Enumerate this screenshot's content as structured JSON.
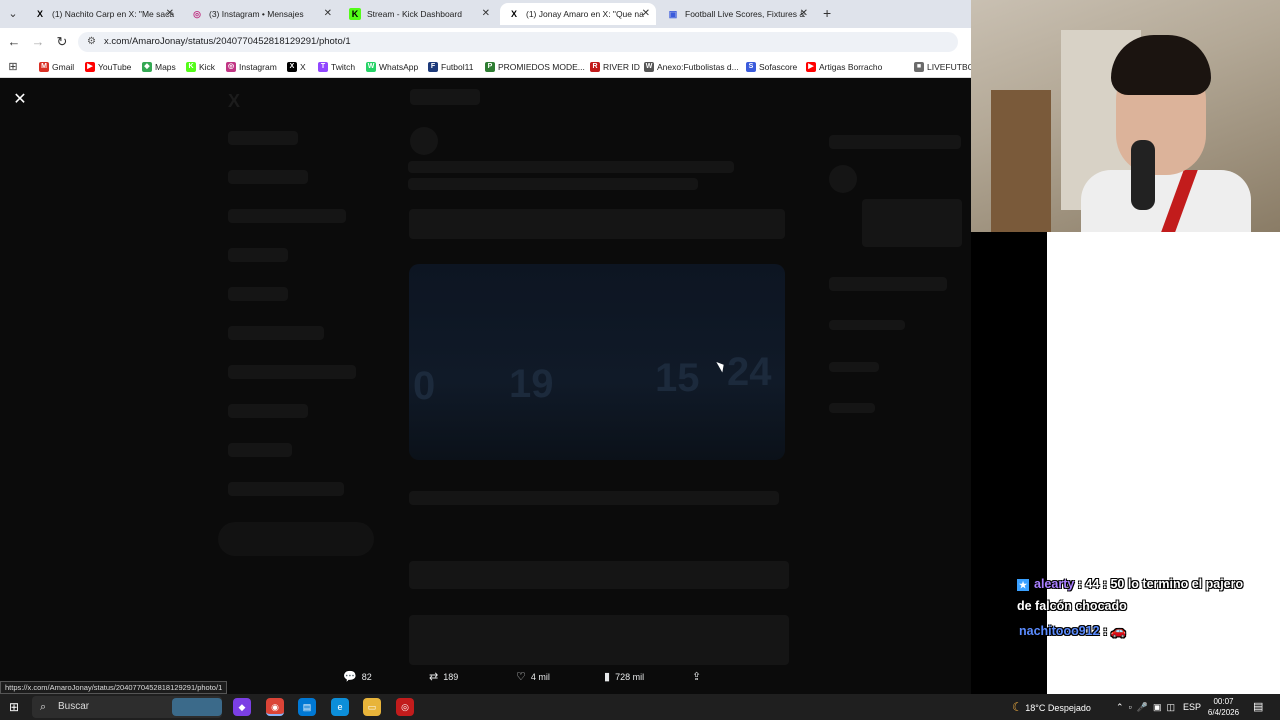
{
  "tabs": [
    {
      "title": "(1) Nachito Carp en X: \"Me saca",
      "icon": "x-logo-icon",
      "fav": "X",
      "active": false
    },
    {
      "title": "(3) Instagram • Mensajes",
      "icon": "instagram-icon",
      "fav": "◎",
      "active": false
    },
    {
      "title": "Stream - Kick Dashboard",
      "icon": "kick-icon",
      "fav": "K",
      "active": false
    },
    {
      "title": "(1) Jonay Amaro en X: \"Que na",
      "icon": "x-logo-icon",
      "fav": "X",
      "active": true
    },
    {
      "title": "Football Live Scores, Fixtures &",
      "icon": "sofascore-icon",
      "fav": "▣",
      "active": false
    }
  ],
  "address": {
    "url": "x.com/AmaroJonay/status/2040770452818129291/photo/1"
  },
  "bookmarks": [
    {
      "label": "Gmail",
      "icon": "gmail-icon",
      "color": "#d93025",
      "glyph": "M"
    },
    {
      "label": "YouTube",
      "icon": "youtube-icon",
      "color": "#ff0000",
      "glyph": "▶"
    },
    {
      "label": "Maps",
      "icon": "maps-icon",
      "color": "#34a853",
      "glyph": "◆"
    },
    {
      "label": "Kick",
      "icon": "kick-icon",
      "color": "#53fc18",
      "glyph": "K"
    },
    {
      "label": "Instagram",
      "icon": "instagram-icon",
      "color": "#c13584",
      "glyph": "◎"
    },
    {
      "label": "X",
      "icon": "x-logo-icon",
      "color": "#000000",
      "glyph": "X"
    },
    {
      "label": "Twitch",
      "icon": "twitch-icon",
      "color": "#9146ff",
      "glyph": "T"
    },
    {
      "label": "WhatsApp",
      "icon": "whatsapp-icon",
      "color": "#25d366",
      "glyph": "W"
    },
    {
      "label": "Futbol11",
      "icon": "futbol11-icon",
      "color": "#1d3a7a",
      "glyph": "F"
    },
    {
      "label": "PROMIEDOS MODE...",
      "icon": "promiedos-icon",
      "color": "#2e7d32",
      "glyph": "P"
    },
    {
      "label": "RIVER ID",
      "icon": "river-icon",
      "color": "#c21c1c",
      "glyph": "R"
    },
    {
      "label": "Anexo:Futbolistas d...",
      "icon": "wikipedia-icon",
      "color": "#555555",
      "glyph": "W"
    },
    {
      "label": "Sofascore",
      "icon": "sofascore-icon",
      "color": "#3b5bdb",
      "glyph": "S"
    },
    {
      "label": "Artigas Borracho",
      "icon": "youtube-icon",
      "color": "#ff0000",
      "glyph": "▶"
    },
    {
      "label": "LIVEFUTBOL",
      "icon": "bookmark-icon",
      "color": "#6b6b6b",
      "glyph": "■"
    }
  ],
  "post_actions": {
    "replies": "82",
    "reposts": "189",
    "likes": "4 mil",
    "views": "728 mil"
  },
  "status_url": "https://x.com/AmaroJonay/status/2040770452818129291/photo/1",
  "chat": [
    {
      "user": "alearty",
      "text": ": 44 : 50 lo termino el pajero",
      "cont": "de falcón chocado"
    },
    {
      "user": "nachitooo912",
      "text": ":",
      "emote": "🚗"
    }
  ],
  "taskbar": {
    "search_placeholder": "Buscar",
    "weather": "18°C  Despejado",
    "lang": "ESP",
    "time": "00:07",
    "date": "6/4/2026"
  }
}
